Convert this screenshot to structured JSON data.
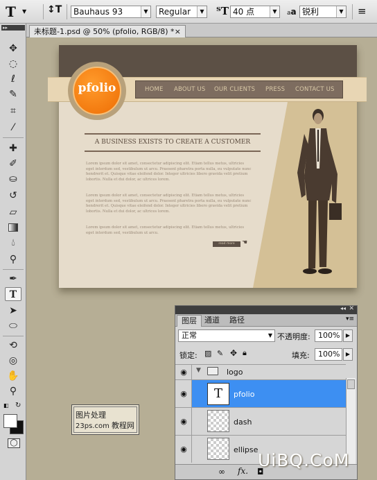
{
  "options_bar": {
    "tool_glyph": "T",
    "font_family": "Bauhaus 93",
    "font_style": "Regular",
    "font_size": "40 点",
    "aa_label": "a",
    "antialias": "锐利"
  },
  "document_tab": {
    "title": "未标题-1.psd @ 50% (pfolio, RGB/8) *",
    "close": "×"
  },
  "design": {
    "logo": "pfolio",
    "nav": [
      "HOME",
      "ABOUT US",
      "OUR CLIENTS",
      "PRESS",
      "CONTACT US"
    ],
    "headline": "A BUSINESS EXISTS TO CREATE A CUSTOMER",
    "paragraphs": [
      "Lorem ipsum dolor sit amet, consectetur adipiscing elit. Etiam tellus metus, ultricies eget interdum sed, vestibulum ut arcu. Praesent pharetra porta nulla, eu vulputate nunc hendrerit et. Quisque vitae eleifend dolor. Integer ultricies libero gravida velit pretium lobortis. Nulla et dui dolor, ac ultrices lorem.",
      "Lorem ipsum dolor sit amet, consectetur adipiscing elit. Etiam tellus metus, ultricies eget interdum sed, vestibulum ut arcu. Praesent pharetra porta nulla, eu vulputate nunc hendrerit et. Quisque vitae eleifend dolor. Integer ultricies libero gravida velit pretium lobortis. Nulla et dui dolor, ac ultrices lorem.",
      "Lorem ipsum dolor sit amet, consectetur adipiscing elit. Etiam tellus metus, ultricies eget interdum sed, vestibulum ut arcu."
    ],
    "read_more": "read more"
  },
  "stamp": {
    "line1": "图片处理",
    "line2": "23ps.com",
    "line2_suffix": "教程网"
  },
  "layers_panel": {
    "tabs": [
      "图层",
      "通道",
      "路径"
    ],
    "blend_mode": "正常",
    "opacity_label": "不透明度:",
    "opacity": "100%",
    "lock_label": "锁定:",
    "fill_label": "填充:",
    "fill": "100%",
    "group_name": "logo",
    "layers": [
      {
        "name": "pfolio",
        "type": "text",
        "selected": true,
        "thumb": "T"
      },
      {
        "name": "dash",
        "type": "pixel",
        "selected": false
      },
      {
        "name": "ellipse",
        "type": "pixel",
        "selected": false
      }
    ],
    "fx_label": "fx."
  },
  "brand_watermark": "UiBQ.CoM",
  "colors": {
    "canvas_bg": "#b6ae95",
    "logo_orange": "#ee6d04",
    "selected_layer": "#3d8ff2",
    "header_brown": "#5c5045"
  }
}
